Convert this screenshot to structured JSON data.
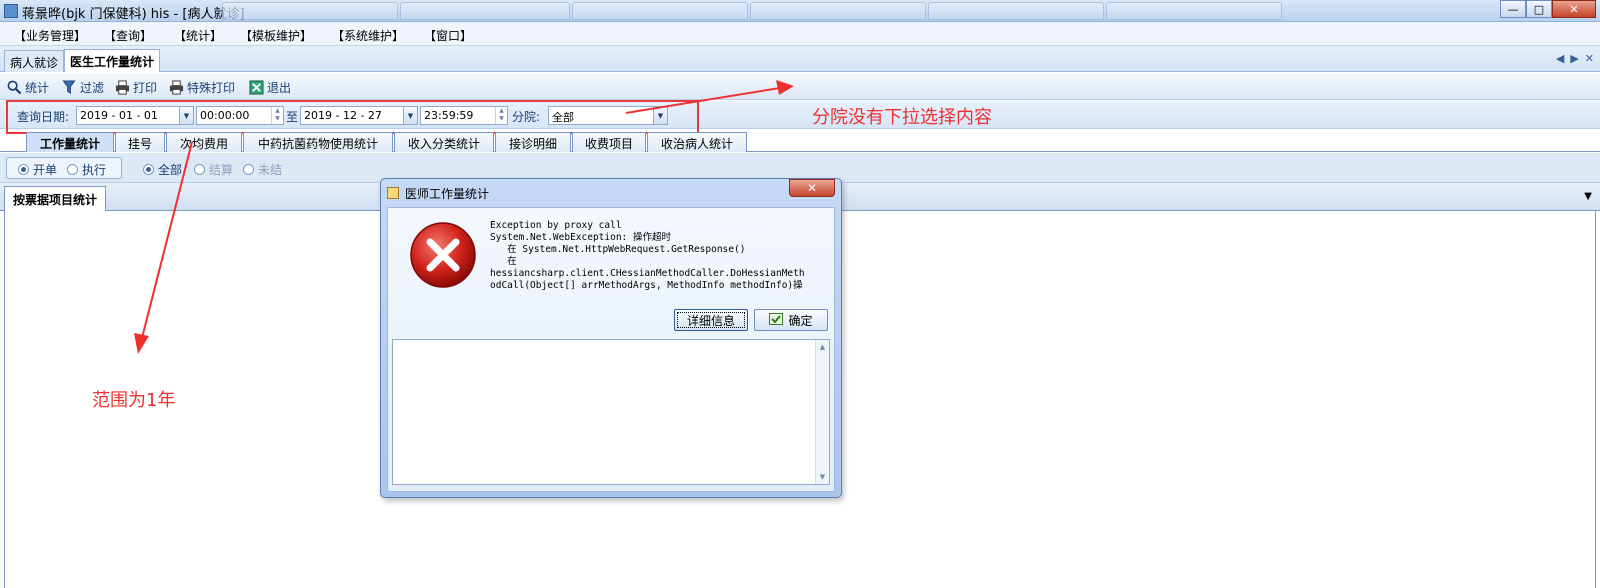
{
  "window": {
    "title": "蒋景晔(bjk 门保健科) his - [病人就诊]",
    "buttons": {
      "minimize": "—",
      "maximize": "□",
      "close": "✕"
    }
  },
  "menu": [
    "【业务管理】",
    "【查询】",
    "【统计】",
    "【模板维护】",
    "【系统维护】",
    "【窗口】"
  ],
  "doc_tabs": [
    {
      "label": "病人就诊",
      "active": false
    },
    {
      "label": "医生工作量统计",
      "active": true
    }
  ],
  "tab_nav": {
    "prev": "◀",
    "next": "▶",
    "close": "✕"
  },
  "toolbar": [
    {
      "label": "统计",
      "icon": "magnifier-icon"
    },
    {
      "label": "过滤",
      "icon": "funnel-icon"
    },
    {
      "label": "打印",
      "icon": "printer-icon"
    },
    {
      "label": "特殊打印",
      "icon": "printer-icon"
    },
    {
      "label": "退出",
      "icon": "exit-icon"
    }
  ],
  "query": {
    "date_label": "查询日期:",
    "start_date": "2019 - 01 - 01",
    "start_time": "00:00:00",
    "to_label": "至",
    "end_date": "2019 - 12 - 27",
    "end_time": "23:59:59",
    "branch_label": "分院:",
    "branch_value": "全部"
  },
  "sub_tabs": [
    {
      "label": "工作量统计",
      "active": true
    },
    {
      "label": "挂号",
      "active": false
    },
    {
      "label": "次均费用",
      "active": false
    },
    {
      "label": "中药抗菌药物使用统计",
      "active": false
    },
    {
      "label": "收入分类统计",
      "active": false
    },
    {
      "label": "接诊明细",
      "active": false
    },
    {
      "label": "收费项目",
      "active": false
    },
    {
      "label": "收治病人统计",
      "active": false
    }
  ],
  "radios": {
    "mode": [
      {
        "label": "开单",
        "checked": true
      },
      {
        "label": "执行",
        "checked": false
      }
    ],
    "settle": [
      {
        "label": "全部",
        "checked": true
      },
      {
        "label": "结算",
        "checked": false
      },
      {
        "label": "未结",
        "checked": false
      }
    ]
  },
  "inner_tab": "按票据项目统计",
  "dialog": {
    "title": "医师工作量统计",
    "close": "✕",
    "message_lines": [
      "Exception by proxy call",
      "System.Net.WebException: 操作超时",
      "   在 System.Net.HttpWebRequest.GetResponse()",
      "   在",
      "hessiancsharp.client.CHessianMethodCaller.DoHessianMeth",
      "odCall(Object[] arrMethodArgs, MethodInfo methodInfo)操"
    ],
    "detail_button": "详细信息",
    "ok_button": "确定"
  },
  "annotations": {
    "branch_note": "分院没有下拉选择内容",
    "range_note": "范围为1年"
  },
  "colors": {
    "annotation": "#f03030",
    "error_red": "#c8102e"
  }
}
